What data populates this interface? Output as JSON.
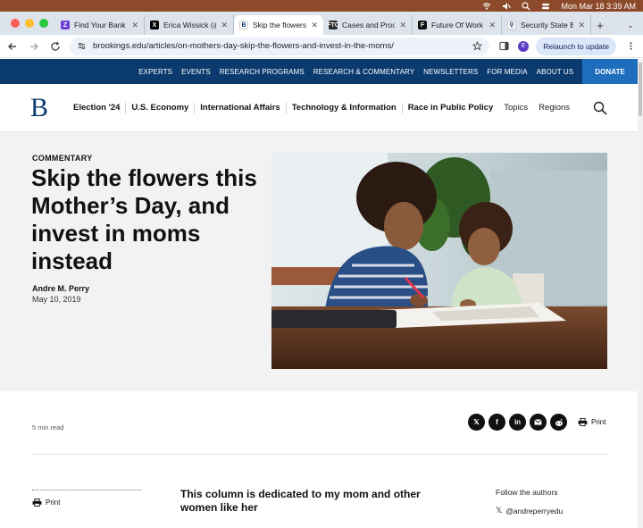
{
  "menubar": {
    "datetime": "Mon Mar 18  3:39 AM"
  },
  "tabs": [
    {
      "title": "Find Your Bank | ",
      "favicon": "purple-z-icon",
      "color": "#6b3fd6",
      "glyph": "Z",
      "active": false
    },
    {
      "title": "Erica Wissick (@",
      "favicon": "x-icon",
      "color": "#000000",
      "glyph": "X",
      "active": false
    },
    {
      "title": "Skip the flowers t",
      "favicon": "brookings-b-icon",
      "color": "#ffffff",
      "glyph": "B",
      "active": true
    },
    {
      "title": "Cases and Proce",
      "favicon": "ftc-icon",
      "color": "#2b2b2b",
      "glyph": "FTC",
      "active": false
    },
    {
      "title": "Future Of Work",
      "favicon": "forbes-f-icon",
      "color": "#111111",
      "glyph": "F",
      "active": false
    },
    {
      "title": "Security State Ba",
      "favicon": "bank-icon",
      "color": "#ffffff",
      "glyph": "⚲",
      "active": false
    }
  ],
  "toolbar": {
    "url": "brookings.edu/articles/on-mothers-day-skip-the-flowers-and-invest-in-the-moms/",
    "profile_initial": "E",
    "relaunch_label": "Relaunch to update"
  },
  "topnav": [
    "EXPERTS",
    "EVENTS",
    "RESEARCH PROGRAMS",
    "RESEARCH & COMMENTARY",
    "NEWSLETTERS",
    "FOR MEDIA",
    "ABOUT US"
  ],
  "donate_label": "DONATE",
  "logo": "B",
  "mainnav": {
    "bold_items": [
      "Election '24",
      "U.S. Economy",
      "International Affairs",
      "Technology & Information",
      "Race in Public Policy"
    ],
    "plain_items": [
      "Topics",
      "Regions"
    ]
  },
  "article": {
    "kicker": "COMMENTARY",
    "headline": "Skip the flowers this Mother’s Day, and invest in moms instead",
    "author": "Andre M. Perry",
    "date": "May 10, 2019",
    "read_time": "5 min read",
    "print_label": "Print",
    "column_title": "This column is dedicated to my mom and other women like her",
    "follow_label": "Follow the authors",
    "author_handle": "@andreperryedu"
  },
  "colors": {
    "brand_navy": "#0b3a6e",
    "donate_blue": "#1f6ebd",
    "hero_bg": "#f2f2f2"
  }
}
